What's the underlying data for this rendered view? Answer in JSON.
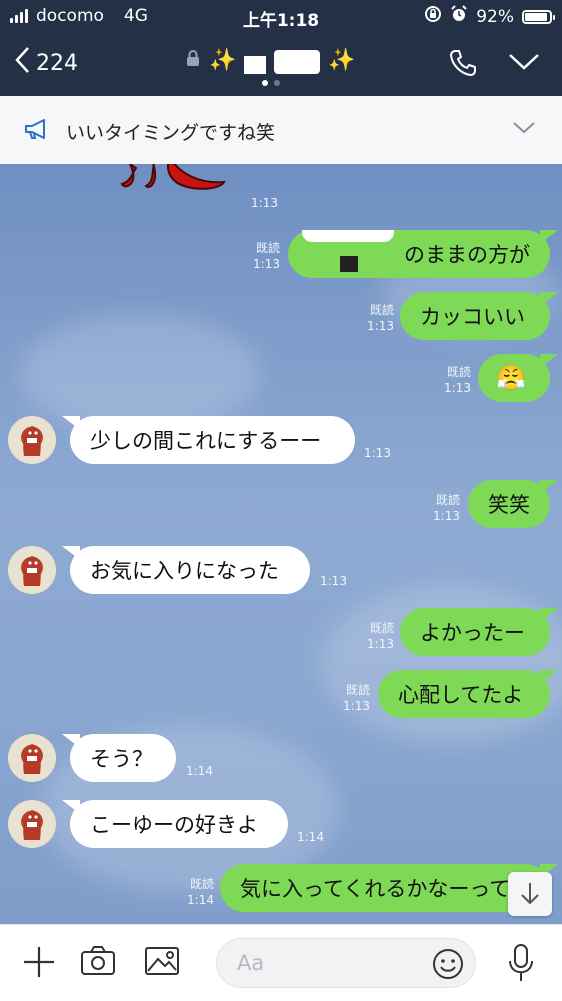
{
  "status_bar": {
    "carrier": "docomo",
    "network": "4G",
    "time": "上午1:18",
    "battery": "92%",
    "battery_level": 0.92
  },
  "header": {
    "unread_count": "224",
    "title_sparkle_left": "✨",
    "title_sparkle_right": "✨"
  },
  "announcement": {
    "text": "いいタイミングですね笑"
  },
  "messages": [
    {
      "side": "me",
      "text": "のままの方が",
      "read": "既読",
      "time": "1:13"
    },
    {
      "side": "me",
      "text": "カッコいい",
      "read": "既読",
      "time": "1:13"
    },
    {
      "side": "me",
      "text": "😤",
      "read": "既読",
      "time": "1:13"
    },
    {
      "side": "them",
      "text": "少しの間これにするーー",
      "time": "1:13"
    },
    {
      "side": "me",
      "text": "笑笑",
      "read": "既読",
      "time": "1:13"
    },
    {
      "side": "them",
      "text": "お気に入りになった",
      "time": "1:13"
    },
    {
      "side": "me",
      "text": "よかったー",
      "read": "既読",
      "time": "1:13"
    },
    {
      "side": "me",
      "text": "心配してたよ",
      "read": "既読",
      "time": "1:13"
    },
    {
      "side": "them",
      "text": "そう？",
      "time": "1:14"
    },
    {
      "side": "them",
      "text": "こーゆーの好きよ",
      "time": "1:14"
    },
    {
      "side": "me",
      "text": "気に入ってくれるかなーって",
      "read": "既読",
      "time": "1:14"
    }
  ],
  "sticker_time": "1:13",
  "input": {
    "placeholder": "Aa"
  },
  "icons": {
    "back": "chevron-left-icon",
    "lock": "lock-icon",
    "phone": "phone-icon",
    "menu": "chevron-down-icon",
    "announcement": "megaphone-icon",
    "add": "plus-icon",
    "camera": "camera-icon",
    "image": "image-icon",
    "emoji": "smile-icon",
    "mic": "microphone-icon",
    "scroll": "arrow-down-icon"
  },
  "colors": {
    "header_bg": "#233046",
    "my_bubble": "#7ed957",
    "their_bubble": "#ffffff",
    "chat_bg": "#7f9cc9"
  }
}
